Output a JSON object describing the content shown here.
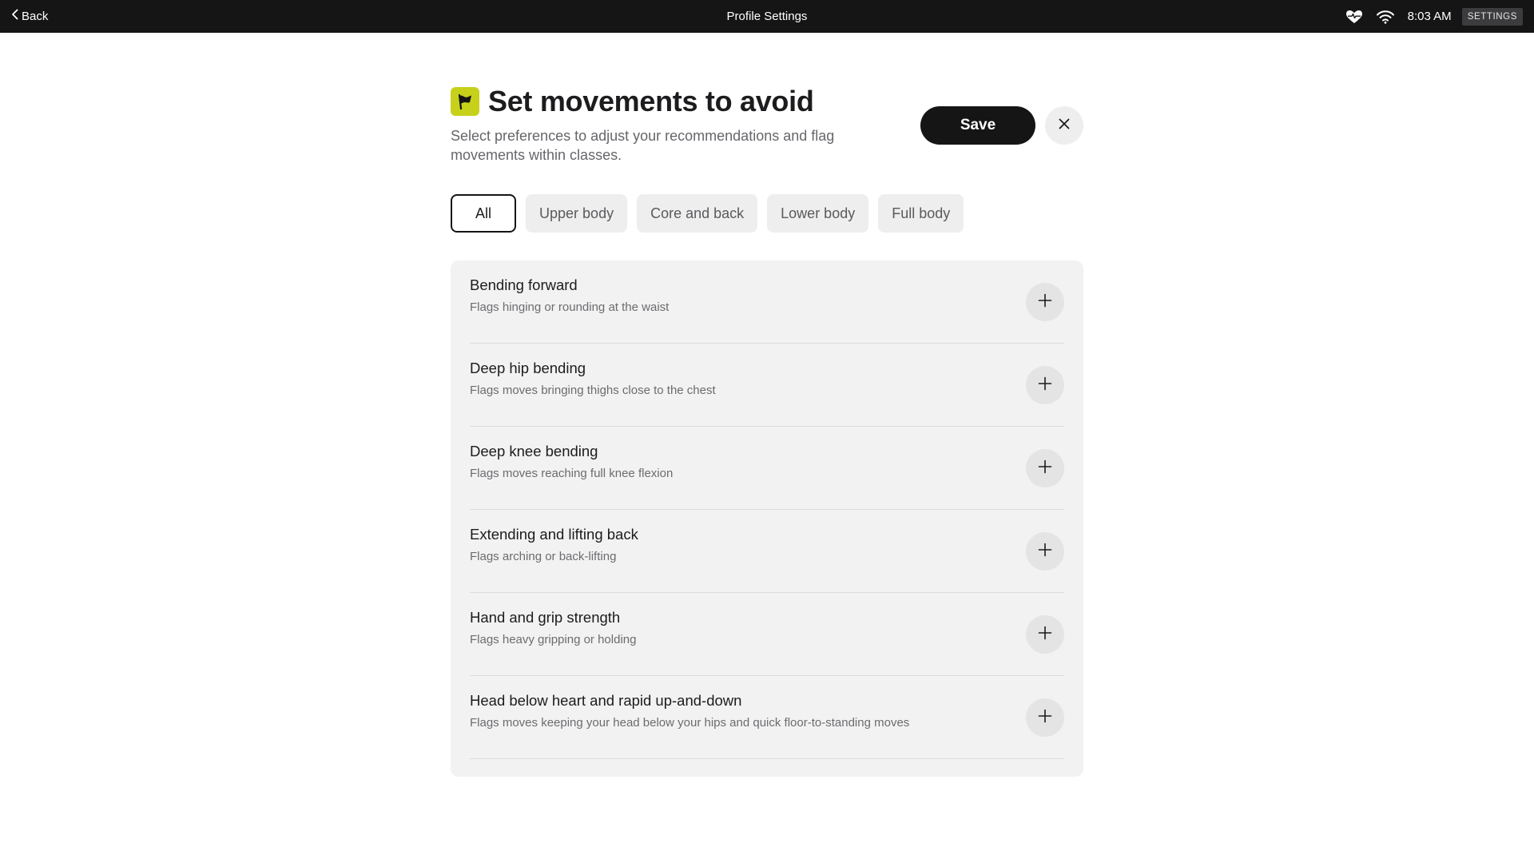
{
  "topbar": {
    "back_label": "Back",
    "title": "Profile Settings",
    "time": "8:03 AM",
    "settings_label": "SETTINGS"
  },
  "header": {
    "title": "Set movements to avoid",
    "subtitle": "Select preferences to adjust your recommendations and flag movements within classes.",
    "save_label": "Save",
    "accent_color": "#c7d11a"
  },
  "filters": [
    {
      "label": "All",
      "selected": true
    },
    {
      "label": "Upper body",
      "selected": false
    },
    {
      "label": "Core and back",
      "selected": false
    },
    {
      "label": "Lower body",
      "selected": false
    },
    {
      "label": "Full body",
      "selected": false
    }
  ],
  "movements": [
    {
      "title": "Bending forward",
      "description": "Flags hinging or rounding at the waist"
    },
    {
      "title": "Deep hip bending",
      "description": "Flags moves bringing thighs close to the chest"
    },
    {
      "title": "Deep knee bending",
      "description": "Flags moves reaching full knee flexion"
    },
    {
      "title": "Extending and lifting back",
      "description": "Flags arching or back-lifting"
    },
    {
      "title": "Hand and grip strength",
      "description": "Flags heavy gripping or holding"
    },
    {
      "title": "Head below heart and rapid up-and-down",
      "description": "Flags moves keeping your head below your hips and quick floor-to-standing moves"
    }
  ]
}
